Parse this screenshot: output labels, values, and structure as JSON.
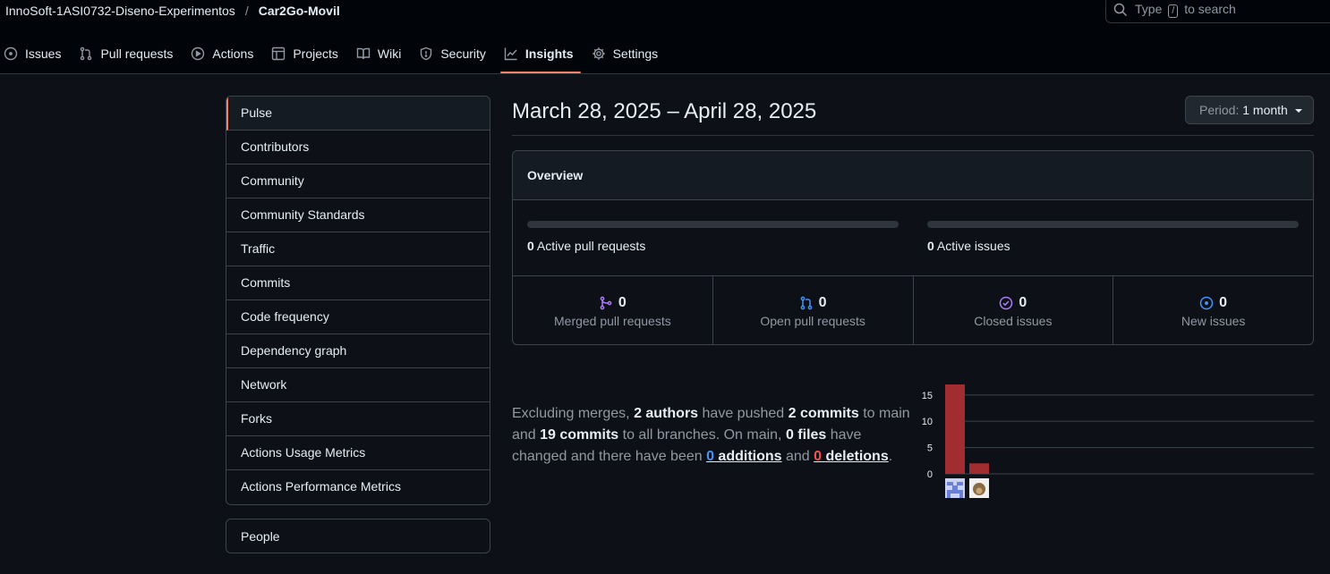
{
  "header": {
    "owner": "InnoSoft-1ASI0732-Diseno-Experimentos",
    "separator": "/",
    "repo": "Car2Go-Movil",
    "search_prefix": "Type",
    "search_key": "/",
    "search_suffix": "to search"
  },
  "tabs": [
    {
      "label": "Issues",
      "icon": "issue-icon"
    },
    {
      "label": "Pull requests",
      "icon": "pull-request-icon"
    },
    {
      "label": "Actions",
      "icon": "play-icon"
    },
    {
      "label": "Projects",
      "icon": "table-icon"
    },
    {
      "label": "Wiki",
      "icon": "book-icon"
    },
    {
      "label": "Security",
      "icon": "shield-icon"
    },
    {
      "label": "Insights",
      "icon": "graph-icon"
    },
    {
      "label": "Settings",
      "icon": "gear-icon"
    }
  ],
  "sidebar": {
    "items": [
      "Pulse",
      "Contributors",
      "Community",
      "Community Standards",
      "Traffic",
      "Commits",
      "Code frequency",
      "Dependency graph",
      "Network",
      "Forks",
      "Actions Usage Metrics",
      "Actions Performance Metrics"
    ],
    "people": "People"
  },
  "main": {
    "date_range": "March 28, 2025 – April 28, 2025",
    "period_label": "Period:",
    "period_value": "1 month",
    "overview": {
      "title": "Overview",
      "active_prs_count": "0",
      "active_prs_label": "Active pull requests",
      "active_issues_count": "0",
      "active_issues_label": "Active issues",
      "stats": [
        {
          "count": "0",
          "label": "Merged pull requests",
          "icon": "merge-icon",
          "color": "#ab7df8"
        },
        {
          "count": "0",
          "label": "Open pull requests",
          "icon": "pull-request-icon",
          "color": "#4493f8"
        },
        {
          "count": "0",
          "label": "Closed issues",
          "icon": "check-circle-icon",
          "color": "#ab7df8"
        },
        {
          "count": "0",
          "label": "New issues",
          "icon": "issue-icon",
          "color": "#4493f8"
        }
      ]
    },
    "summary": {
      "t1": "Excluding merges, ",
      "authors": "2 authors",
      "t2": " have pushed ",
      "commits_main": "2 commits",
      "t3": " to main and ",
      "commits_all": "19 commits",
      "t4": " to all branches. On main, ",
      "files": "0 files",
      "t5": " have changed and there have been ",
      "additions_count": "0",
      "additions_label": " additions",
      "t6": " and ",
      "deletions_count": "0",
      "deletions_label": " deletions",
      "t7": "."
    }
  },
  "chart_data": {
    "type": "bar",
    "categories": [
      "author-1",
      "author-2"
    ],
    "values": [
      17,
      2
    ],
    "ylim": [
      0,
      17
    ],
    "yticks": [
      0,
      5,
      10,
      15
    ],
    "bar_color": "#a22d30",
    "grid": true
  }
}
